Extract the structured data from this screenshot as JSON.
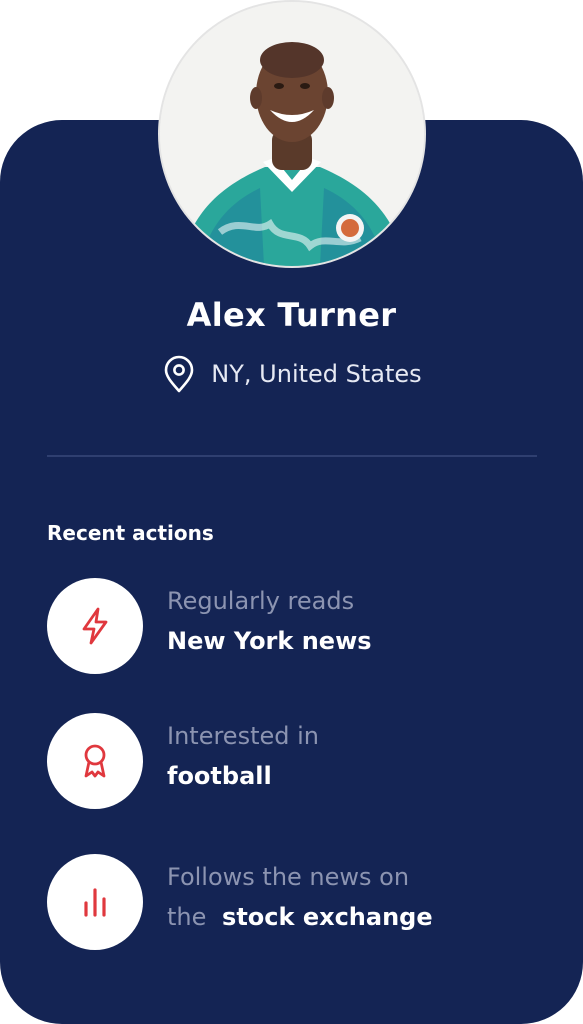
{
  "profile": {
    "name": "Alex Turner",
    "location": "NY, United States"
  },
  "recent_actions": {
    "title": "Recent actions",
    "items": [
      {
        "icon": "lightning-icon",
        "line1": "Regularly reads",
        "highlight": "New York news"
      },
      {
        "icon": "award-ribbon-icon",
        "line1": "Interested in",
        "highlight": "football"
      },
      {
        "icon": "bar-chart-icon",
        "line1": "Follows the news on",
        "prefix": "the",
        "highlight": "stock exchange"
      }
    ]
  },
  "colors": {
    "card_background": "#142454",
    "accent_red": "#e0383e",
    "muted_text": "#8c94b1"
  }
}
